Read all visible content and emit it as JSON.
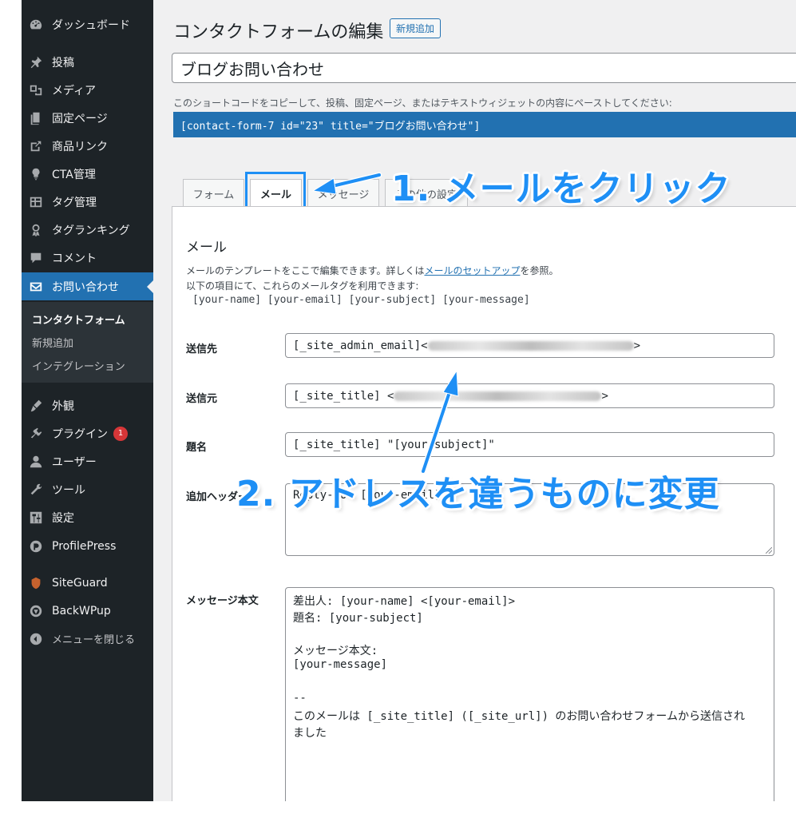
{
  "sidebar": {
    "items": [
      {
        "label": "ダッシュボード",
        "icon": "dashboard-icon"
      },
      {
        "label": "投稿",
        "icon": "pin-icon"
      },
      {
        "label": "メディア",
        "icon": "media-icon"
      },
      {
        "label": "固定ページ",
        "icon": "page-icon"
      },
      {
        "label": "商品リンク",
        "icon": "link-icon"
      },
      {
        "label": "CTA管理",
        "icon": "lightbulb-icon"
      },
      {
        "label": "タグ管理",
        "icon": "table-icon"
      },
      {
        "label": "タグランキング",
        "icon": "award-icon"
      },
      {
        "label": "コメント",
        "icon": "comment-icon"
      },
      {
        "label": "お問い合わせ",
        "icon": "mail-icon"
      }
    ],
    "submenu": [
      "コンタクトフォーム",
      "新規追加",
      "インテグレーション"
    ],
    "items2": [
      {
        "label": "外観",
        "icon": "appearance-icon"
      },
      {
        "label": "プラグイン",
        "icon": "plugin-icon",
        "badge": "1"
      },
      {
        "label": "ユーザー",
        "icon": "user-icon"
      },
      {
        "label": "ツール",
        "icon": "wrench-icon"
      },
      {
        "label": "設定",
        "icon": "settings-icon"
      },
      {
        "label": "ProfilePress",
        "icon": "profilepress-icon"
      }
    ],
    "items3": [
      {
        "label": "SiteGuard",
        "icon": "shield-icon"
      },
      {
        "label": "BackWPup",
        "icon": "backwpup-icon"
      },
      {
        "label": "メニューを閉じる",
        "icon": "collapse-icon"
      }
    ]
  },
  "header": {
    "title": "コンタクトフォームの編集",
    "add_new": "新規追加"
  },
  "form_title": "ブログお問い合わせ",
  "shortcode": {
    "description": "このショートコードをコピーして、投稿、固定ページ、またはテキストウィジェットの内容にペーストしてください:",
    "code": "[contact-form-7 id=\"23\" title=\"ブログお問い合わせ\"]"
  },
  "tabs": [
    "フォーム",
    "メール",
    "メッセージ",
    "その他の設定"
  ],
  "mail": {
    "heading": "メール",
    "desc1_prefix": "メールのテンプレートをここで編集できます。詳しくは",
    "desc1_link": "メールのセットアップ",
    "desc1_suffix": "を参照。",
    "desc2": "以下の項目にて、これらのメールタグを利用できます:",
    "mailtags": "[your-name] [your-email] [your-subject] [your-message]",
    "to_label": "送信先",
    "to_value": "[_site_admin_email]<",
    "to_end": ">",
    "from_label": "送信元",
    "from_value": "[_site_title] <",
    "from_end": ">",
    "subject_label": "題名",
    "subject_value": "[_site_title] \"[your-subject]\"",
    "headers_label": "追加ヘッダー",
    "headers_value": "Reply-To: [your-email]",
    "body_label": "メッセージ本文",
    "body_lines": [
      "差出人: [your-name] <[your-email]>",
      "題名: [your-subject]",
      "",
      "メッセージ本文:",
      "[your-message]",
      "",
      "--",
      "このメールは [_site_title] ([_site_url]) のお問い合わせフォームから送信され",
      "ました"
    ]
  },
  "annotations": {
    "step1": "1. メールをクリック",
    "step2": "2. アドレスを違うものに変更"
  },
  "colors": {
    "sidebar_bg": "#1d2327",
    "accent": "#2271b1",
    "annotation": "#1e8ff5",
    "badge": "#d63638"
  }
}
